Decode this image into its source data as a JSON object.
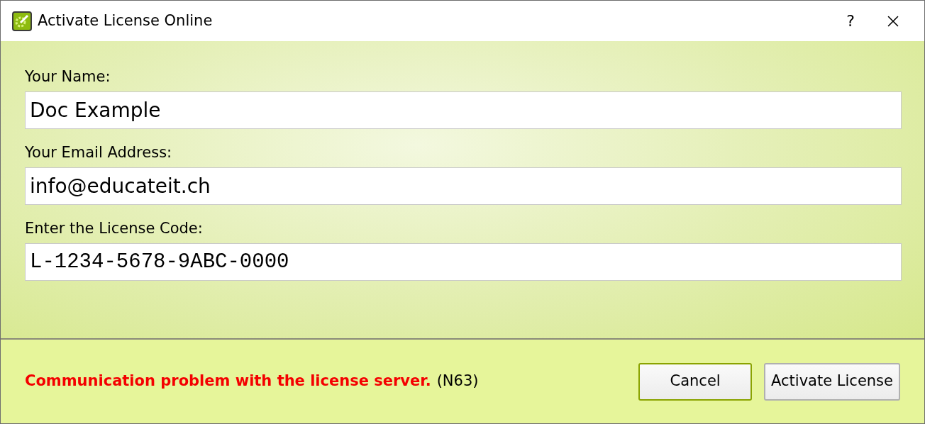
{
  "window": {
    "title": "Activate License Online",
    "help": "?"
  },
  "fields": [
    {
      "label": "Your Name:",
      "value": "Doc Example",
      "kind": "text"
    },
    {
      "label": "Your Email Address:",
      "value": "info@educateit.ch",
      "kind": "text"
    },
    {
      "label": "Enter the License Code:",
      "value": "L-1234-5678-9ABC-0000",
      "kind": "code"
    }
  ],
  "error": {
    "message": "Communication problem with the license server.",
    "code": "(N63)"
  },
  "buttons": [
    {
      "label": "Cancel",
      "focused": true
    },
    {
      "label": "Activate License",
      "focused": false
    }
  ]
}
